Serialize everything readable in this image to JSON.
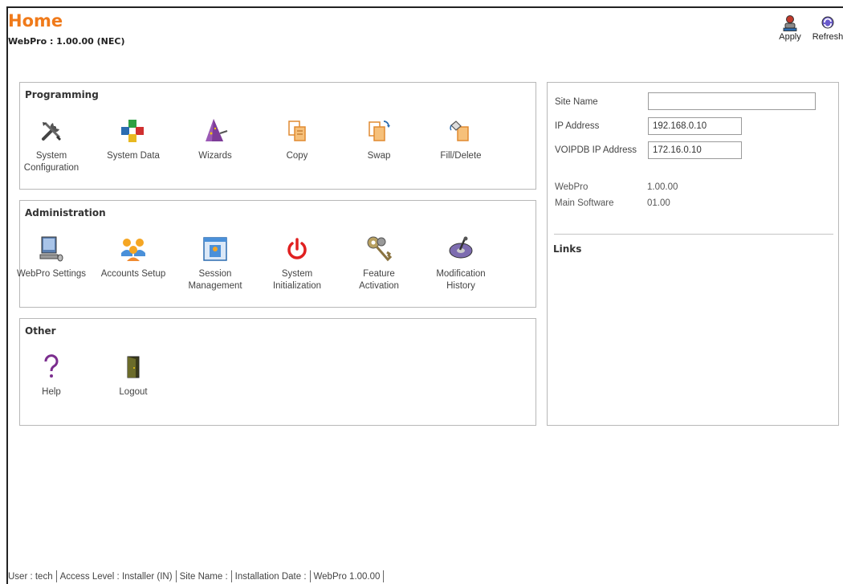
{
  "header": {
    "title": "Home",
    "subtitle": "WebPro : 1.00.00 (NEC)"
  },
  "toolbar": {
    "apply_label": "Apply",
    "refresh_label": "Refresh"
  },
  "programming": {
    "title": "Programming",
    "items": [
      {
        "label": "System Configuration",
        "icon": "tools-icon"
      },
      {
        "label": "System Data",
        "icon": "blocks-icon"
      },
      {
        "label": "Wizards",
        "icon": "wizard-hat-icon"
      },
      {
        "label": "Copy",
        "icon": "copy-icon"
      },
      {
        "label": "Swap",
        "icon": "swap-icon"
      },
      {
        "label": "Fill/Delete",
        "icon": "fill-delete-icon"
      }
    ]
  },
  "administration": {
    "title": "Administration",
    "items": [
      {
        "label": "WebPro Settings",
        "icon": "computer-icon"
      },
      {
        "label": "Accounts Setup",
        "icon": "users-icon"
      },
      {
        "label": "Session Management",
        "icon": "session-window-icon"
      },
      {
        "label": "System Initialization",
        "icon": "power-icon"
      },
      {
        "label": "Feature Activation",
        "icon": "keys-icon"
      },
      {
        "label": "Modification History",
        "icon": "history-disc-icon"
      }
    ]
  },
  "other": {
    "title": "Other",
    "items": [
      {
        "label": "Help",
        "icon": "question-icon"
      },
      {
        "label": "Logout",
        "icon": "door-icon"
      }
    ]
  },
  "site": {
    "site_name_label": "Site Name",
    "site_name_value": "",
    "ip_label": "IP Address",
    "ip_value": "192.168.0.10",
    "voip_label": "VOIPDB IP Address",
    "voip_value": "172.16.0.10",
    "webpro_label": "WebPro",
    "webpro_value": "1.00.00",
    "main_sw_label": "Main Software",
    "main_sw_value": "01.00",
    "links_title": "Links"
  },
  "status": {
    "user": "User : tech",
    "access": "Access Level : Installer (IN)",
    "site_name": "Site Name :",
    "install_date": "Installation Date :",
    "webpro": "WebPro 1.00.00"
  },
  "colors": {
    "title_orange": "#f07a1a",
    "power_red": "#e02020"
  }
}
